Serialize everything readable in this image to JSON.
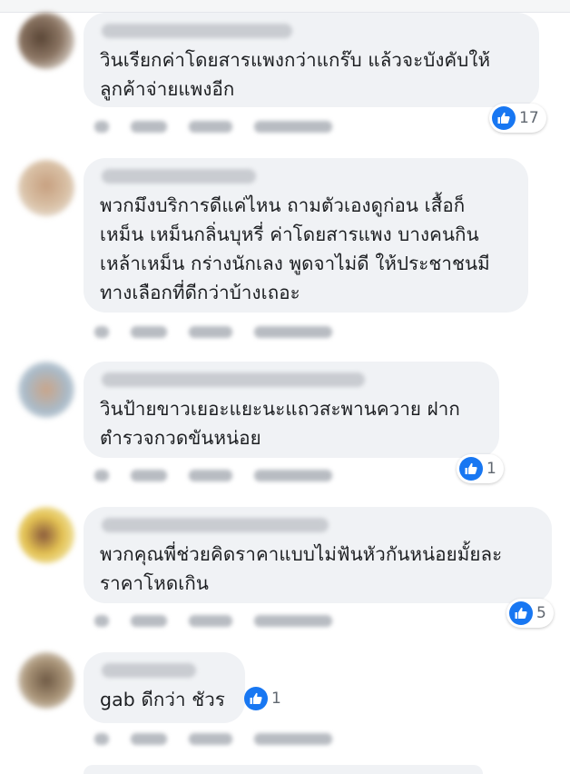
{
  "accent_color": "#1877f2",
  "bubble_color": "#f0f2f5",
  "icon": "like-thumbs-up-icon",
  "comments": [
    {
      "text": "วินเรียกค่าโดยสารแพงกว่าแกร๊บ แล้วจะบังคับให้\nลูกค้าจ่ายแพงอีก",
      "likes": "17"
    },
    {
      "text": "พวกมึงบริการดีแค่ไหน ถามตัวเองดูก่อน เสื้อก็\nเหม็น เหม็นกลิ่นบุหรี่ ค่าโดยสารแพง บางคนกิน\nเหล้าเหม็น กร่างนักเลง พูดจาไม่ดี ให้ประชาชนมี\nทางเลือกที่ดีกว่าบ้างเถอะ",
      "likes": ""
    },
    {
      "text": "วินป้ายขาวเยอะแยะนะแถวสะพานควาย ฝาก\nตำรวจกวดขันหน่อย",
      "likes": "1"
    },
    {
      "text": "พวกคุณพี่ช่วยคิดราคาแบบไม่ฟันหัวกันหน่อยมั้ยละ\nราคาโหดเกิน",
      "likes": "5"
    },
    {
      "text": "gab ดีกว่า ชัวร",
      "likes": "1"
    }
  ]
}
